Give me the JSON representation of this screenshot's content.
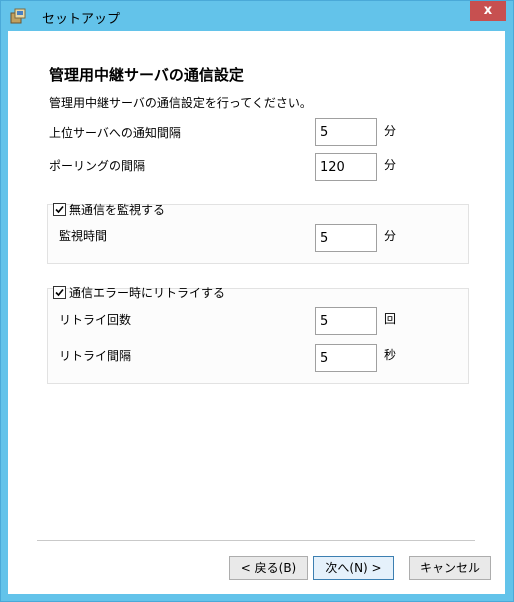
{
  "window": {
    "title": "セットアップ",
    "close_label": "x"
  },
  "page": {
    "heading": "管理用中継サーバの通信設定",
    "description": "管理用中継サーバの通信設定を行ってください。"
  },
  "fields": {
    "notify_interval": {
      "label": "上位サーバへの通知間隔",
      "value": "5",
      "unit": "分"
    },
    "polling_interval": {
      "label": "ポーリングの間隔",
      "value": "120",
      "unit": "分"
    }
  },
  "no_comm_group": {
    "checkbox_label": "無通信を監視する",
    "checked": true,
    "monitor_time": {
      "label": "監視時間",
      "value": "5",
      "unit": "分"
    }
  },
  "retry_group": {
    "checkbox_label": "通信エラー時にリトライする",
    "checked": true,
    "retry_count": {
      "label": "リトライ回数",
      "value": "5",
      "unit": "回"
    },
    "retry_interval": {
      "label": "リトライ間隔",
      "value": "5",
      "unit": "秒"
    }
  },
  "buttons": {
    "back": "< 戻る(B)",
    "next": "次へ(N) >",
    "cancel": "キャンセル"
  }
}
